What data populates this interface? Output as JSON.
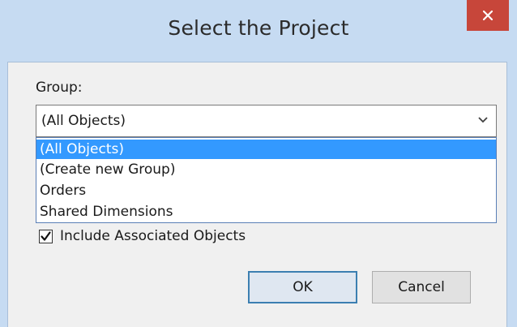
{
  "window": {
    "title": "Select the Project"
  },
  "group": {
    "label": "Group:",
    "selected_value": "(All Objects)",
    "options": [
      "(All Objects)",
      "(Create new Group)",
      "Orders",
      "Shared Dimensions"
    ],
    "highlighted_option": "(All Objects)"
  },
  "include_associated": {
    "label": "Include Associated Objects",
    "checked": true
  },
  "buttons": {
    "ok_label": "OK",
    "cancel_label": "Cancel"
  },
  "icons": {
    "close": "close-icon",
    "dropdown": "chevron-down-icon",
    "check": "check-icon"
  },
  "colors": {
    "title_bar": "#c6dbf2",
    "close_button": "#c7463a",
    "selection": "#3399ff",
    "default_button_border": "#3c7fb1"
  }
}
